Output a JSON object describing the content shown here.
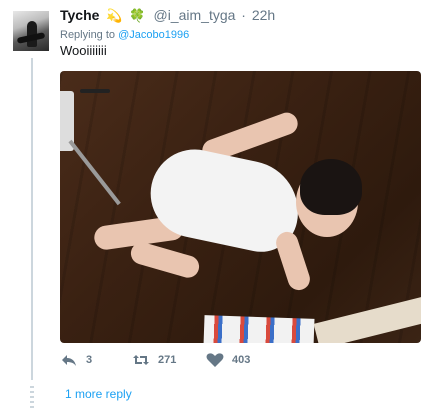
{
  "tweet": {
    "display_name": "Tyche",
    "emojis": [
      "dizzy-emoji",
      "four-leaf-clover-emoji"
    ],
    "handle": "@i_aim_tyga",
    "separator": "·",
    "time": "22h",
    "replying_prefix": "Replying to",
    "replying_to": "@Jacobo1996",
    "text": "Wooiiiiiii"
  },
  "actions": {
    "reply_count": "3",
    "retweet_count": "271",
    "like_count": "403"
  },
  "thread": {
    "more_replies_label": "1 more reply"
  },
  "colors": {
    "link": "#1da1f2",
    "muted": "#657786",
    "thread_line": "#ccd6dd"
  }
}
